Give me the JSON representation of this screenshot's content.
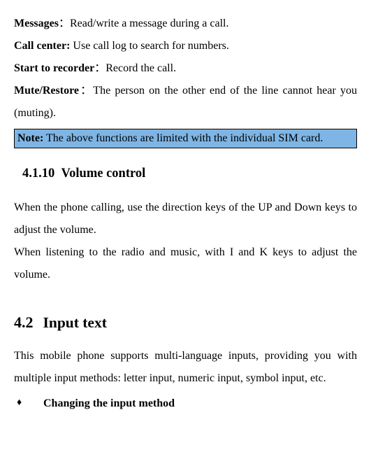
{
  "entries": {
    "messages": {
      "label": "Messages",
      "sep": "：",
      "text": "Read/write a message during a call."
    },
    "callcenter": {
      "label": "Call center:",
      "sep": " ",
      "text": "Use call log to search for numbers."
    },
    "recorder": {
      "label": "Start to recorder",
      "sep": "：",
      "text": "Record the call."
    },
    "mute": {
      "label": "Mute/Restore",
      "sep": "：",
      "text": "The person on the other end of the line cannot hear you (muting)."
    }
  },
  "note": {
    "label": "Note:",
    "text": " The above functions are limited with the individual SIM card."
  },
  "section_4_1_10": {
    "num": "4.1.10",
    "title": "Volume control",
    "p1": "When the phone calling, use the direction keys of the UP and Down keys to adjust the volume.",
    "p2": "When listening to the radio and music, with I and K keys to adjust the volume."
  },
  "section_4_2": {
    "num": "4.2",
    "title": "Input text",
    "p1": "This mobile phone supports multi-language inputs, providing you with multiple input methods: letter input, numeric input, symbol input, etc.",
    "bullet": {
      "symbol": "♦",
      "label": "Changing the input method"
    }
  }
}
